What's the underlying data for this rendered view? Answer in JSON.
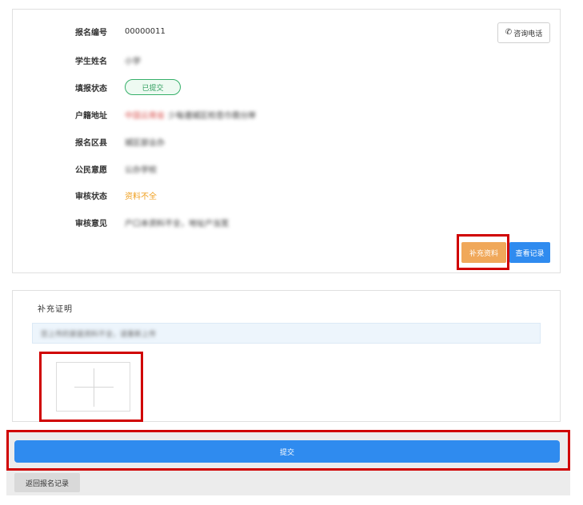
{
  "info": {
    "rows": [
      {
        "label": "报名编号",
        "value": "00000011"
      },
      {
        "label": "学生姓名",
        "value": "小学"
      },
      {
        "label": "填报状态",
        "value": "已提交"
      },
      {
        "label": "户籍地址",
        "value_red": "中国云南省",
        "value": "少每遵城区检悲巾翡分岸"
      },
      {
        "label": "报名区县",
        "value": "城区部业办"
      },
      {
        "label": "公民意愿",
        "value": "公办学校"
      },
      {
        "label": "审核状态",
        "value": "资料不全"
      },
      {
        "label": "审核意见",
        "value": "户口本资料不全，地址户当宽"
      }
    ],
    "phone_button": "咨询电话",
    "supplement_button": "补充资料",
    "record_button": "查看记录"
  },
  "supplement": {
    "title": "补充证明",
    "notice": "您上传的家庭资料不全，请重新上传"
  },
  "actions": {
    "submit": "提交",
    "back": "返回报名记录"
  },
  "icons": {
    "phone": "phone-icon",
    "upload": "plus-icon"
  },
  "colors": {
    "primary": "#2f8bef",
    "warning": "#f0a020",
    "supplement_button": "#f0a85a",
    "success": "#36b06a",
    "highlight": "#d00000"
  }
}
